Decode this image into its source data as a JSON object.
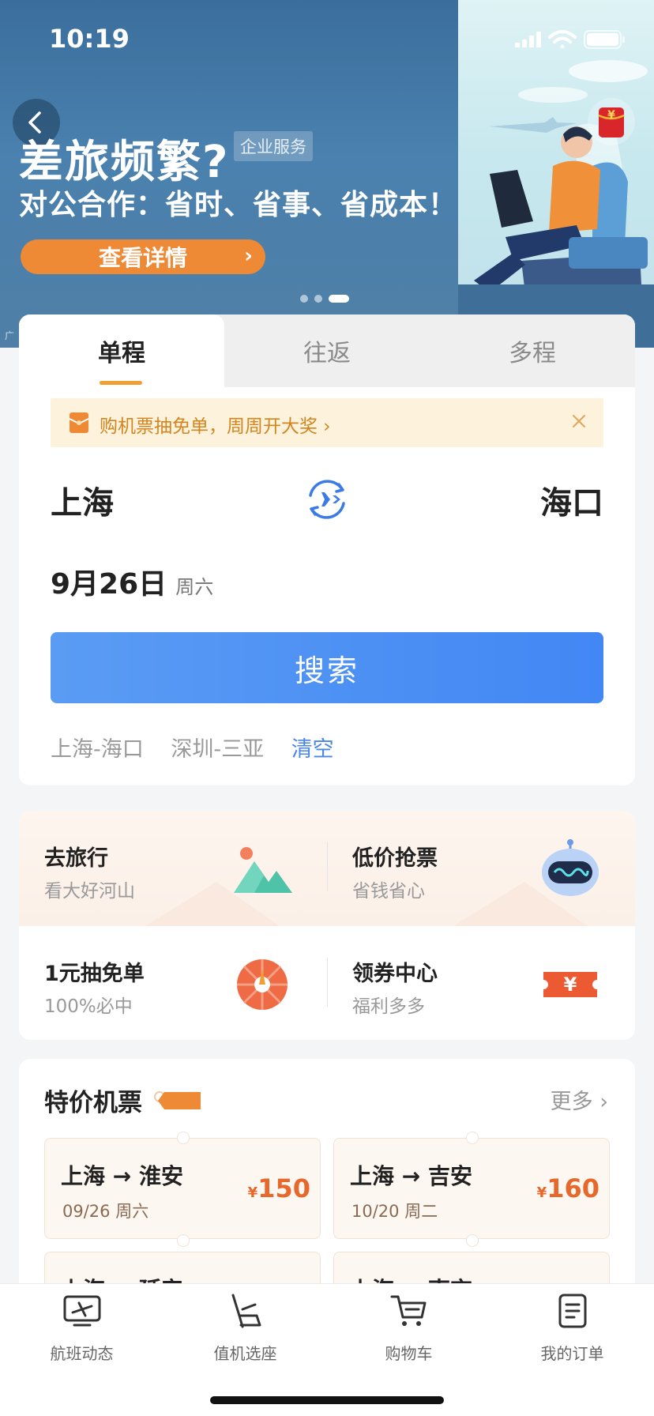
{
  "status_bar": {
    "time": "10:19"
  },
  "banner": {
    "title": "差旅频繁?",
    "tag": "企业服务",
    "subtitle": "对公合作：省时、省事、省成本！",
    "cta_label": "查看详情",
    "ad_label": "广",
    "active_dot": 3,
    "dot_count": 3
  },
  "booking": {
    "tabs": [
      {
        "label": "单程",
        "active": true
      },
      {
        "label": "往返",
        "active": false
      },
      {
        "label": "多程",
        "active": false
      }
    ],
    "promo_text": "购机票抽免单，周周开大奖 ›",
    "from_city": "上海",
    "to_city": "海口",
    "date": "9月26日",
    "weekday": "周六",
    "search_label": "搜索",
    "history": [
      "上海-海口",
      "深圳-三亚"
    ],
    "clear_label": "清空"
  },
  "features": [
    {
      "title": "去旅行",
      "subtitle": "看大好河山",
      "icon": "mountain-icon"
    },
    {
      "title": "低价抢票",
      "subtitle": "省钱省心",
      "icon": "robot-icon"
    },
    {
      "title": "1元抽免单",
      "subtitle": "100%必中",
      "icon": "wheel-icon"
    },
    {
      "title": "领券中心",
      "subtitle": "福利多多",
      "icon": "coupon-icon"
    }
  ],
  "special": {
    "title": "特价机票",
    "more_label": "更多 ›",
    "tickets": [
      {
        "route": "上海 → 淮安",
        "date": "09/26 周六",
        "currency": "¥",
        "price": "150"
      },
      {
        "route": "上海 → 吉安",
        "date": "10/20 周二",
        "currency": "¥",
        "price": "160"
      },
      {
        "route": "上海 → 延安",
        "date": "",
        "currency": "",
        "price": ""
      },
      {
        "route": "上海 → 南京",
        "date": "",
        "currency": "",
        "price": ""
      }
    ]
  },
  "tabbar": [
    {
      "label": "航班动态",
      "icon": "flight-status-icon"
    },
    {
      "label": "值机选座",
      "icon": "seat-icon"
    },
    {
      "label": "购物车",
      "icon": "cart-icon"
    },
    {
      "label": "我的订单",
      "icon": "orders-icon"
    }
  ],
  "colors": {
    "accent_blue": "#4287f4",
    "accent_orange": "#ee8a35",
    "price_orange": "#e8682c",
    "promo_bg": "#fdf3dc"
  }
}
